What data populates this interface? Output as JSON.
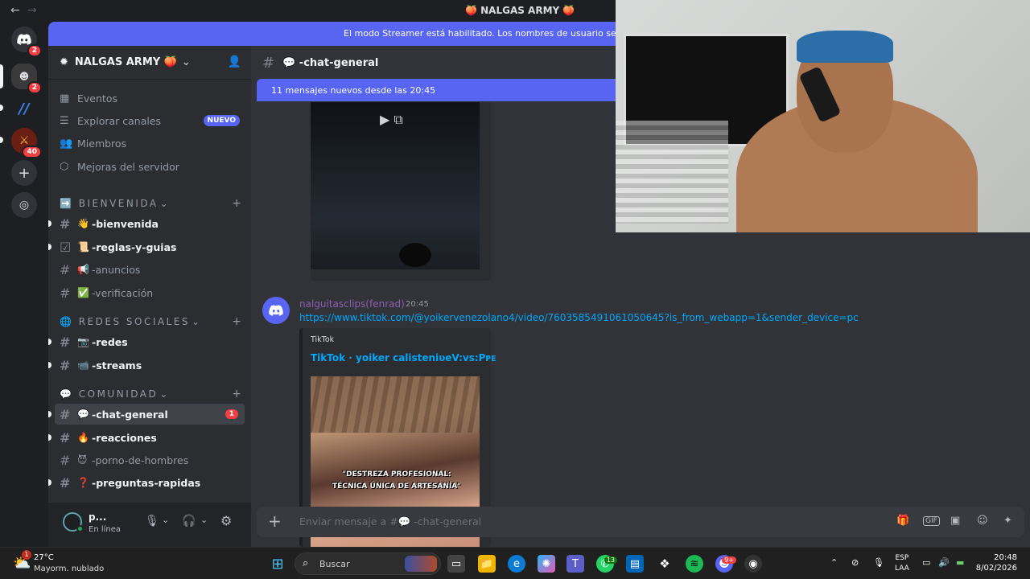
{
  "window": {
    "title": "🍑 NALGAS ARMY 🍑",
    "back": "←",
    "forward": "→"
  },
  "servers": [
    {
      "name": "discord-home",
      "badge": "2"
    },
    {
      "name": "server-avatar-1",
      "badge": "2"
    },
    {
      "name": "server-blue-slash",
      "badge": ""
    },
    {
      "name": "server-nalgas",
      "badge": "40"
    }
  ],
  "banner": {
    "text": "El modo Streamer está habilitado. Los nombres de usuario se han tr"
  },
  "guild": {
    "name": "NALGAS ARMY 🍑"
  },
  "sidebar": {
    "items": [
      {
        "label": "Eventos",
        "icon": "calendar-icon"
      },
      {
        "label": "Explorar canales",
        "icon": "list-icon",
        "badge": "NUEVO"
      },
      {
        "label": "Miembros",
        "icon": "members-icon"
      },
      {
        "label": "Mejoras del servidor",
        "icon": "boost-icon"
      }
    ],
    "categories": [
      {
        "label": "➡️ BIENVENIDA",
        "chevron": "⌄"
      },
      {
        "label": "🌐 REDES SOCIALES",
        "chevron": "⌄"
      },
      {
        "label": "💬 COMUNIDAD",
        "chevron": "⌄"
      }
    ],
    "channels": [
      {
        "emoji": "👋",
        "label": "-bienvenida",
        "state": "unread"
      },
      {
        "emoji": "📜",
        "label": "-reglas-y-guias",
        "state": "unread"
      },
      {
        "emoji": "📢",
        "label": "-anuncios",
        "state": "read"
      },
      {
        "emoji": "✅",
        "label": "-verificación",
        "state": "read"
      },
      {
        "emoji": "📷",
        "label": "-redes",
        "state": "unread"
      },
      {
        "emoji": "📹",
        "label": "-streams",
        "state": "unread"
      },
      {
        "emoji": "💬",
        "label": "-chat-general",
        "state": "active",
        "badge": "1"
      },
      {
        "emoji": "🔥",
        "label": "-reacciones",
        "state": "unread"
      },
      {
        "emoji": "😈",
        "label": "-porno-de-hombres",
        "state": "read"
      },
      {
        "emoji": "❓",
        "label": "-preguntas-rapidas",
        "state": "unread"
      }
    ]
  },
  "user": {
    "name": "p...",
    "status": "En línea"
  },
  "channel": {
    "name": "💬 -chat-general"
  },
  "new_messages": "11 mensajes nuevos desde las 20:45",
  "message": {
    "author": "nalguitasclips(fenrad)",
    "time": "20:45",
    "link": "https://www.tiktok.com/@yoikervenezolano4/video/7603585491061050645?is_from_webapp=1&sender_device=pc",
    "embed_provider": "TikTok",
    "embed_title": "TikTok · yoiker calisteniʋeV:vs:Pᴘᴇ",
    "caption_1": "\"DESTREZA PROFESIONAL:",
    "caption_2": "TÉCNICA ÚNICA DE ARTESANÍA\""
  },
  "composer": {
    "placeholder": "Enviar mensaje a #💬 -chat-general"
  },
  "taskbar": {
    "weather_temp": "27°C",
    "weather_cond": "Mayorm. nublado",
    "weather_badge": "1",
    "search": "Buscar",
    "whatsapp_badge": "13",
    "discord_badge": "9+",
    "lang_1": "ESP",
    "lang_2": "LAA",
    "time": "20:48",
    "date": "8/02/2026"
  }
}
